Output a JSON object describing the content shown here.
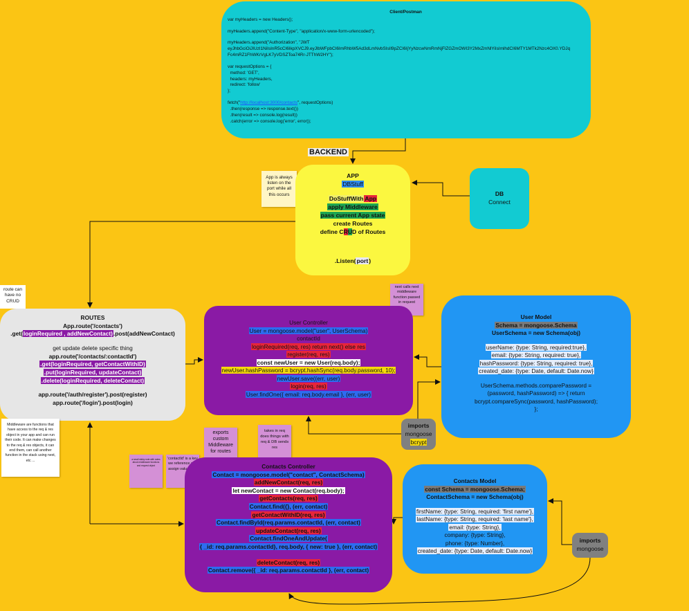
{
  "client": {
    "title": "Client/Postman",
    "lines": [
      "var myHeaders = new Headers();",
      "",
      "myHeaders.append(\"Content-Type\", \"application/x-www-form-urlencoded\");",
      "",
      "myHeaders.append(\"Authorization\", \"JWT",
      "eyJhbGciOiJIUzI1NiIsInR5cCI6IkpXVCJ9.eyJlbWFpbCI6ImRhbW5Ad3dLmNvbSIsIl9pZCI6IjYyNzcwNmRmNjFlZGZmOWI3Y2MxZmNlYiIsImlhdCI6MTY1MTk2Nzc4OX0.YDJq",
      "Fc4mRZ1FhWKrVgLK7yVDSZToa74Rr-JTThW2HY\");",
      "",
      "var requestOptions = {",
      "  method: 'GET',",
      "  headers: myHeaders,",
      "  redirect: 'follow'",
      "};",
      "",
      "fetch(\"http://localhost:3000/contacts\", requestOptions)",
      "  .then(response => response.text())",
      "  .then(result => console.log(result))",
      "  .catch(error => console.log('error', error));"
    ],
    "fetch_url": "http://localhost:3000/contacts"
  },
  "backend_label": "BACKEND",
  "app": {
    "title": "APP",
    "db_stuff": "DBStuff",
    "do_stuff": "DoStuffWith",
    "do_stuff_app": "App",
    "apply_middleware": "apply Middleware",
    "pass_state": "pass current App state",
    "create_routes": "create Routes",
    "define_crud_pre": "define C",
    "define_crud_r": "R",
    "define_crud_u": "U",
    "define_crud_d": "D",
    "define_crud_post": " of Routes",
    "listen": ".Listen(",
    "listen_arg": "port",
    "listen_close": ")"
  },
  "note_app": "App is always listen on the port while all this occurs",
  "db": {
    "title": "DB",
    "subtitle": "Connect"
  },
  "note_route": "route can have no CRUD",
  "routes": {
    "title": "ROUTES",
    "line1": "App.route('/contacts')",
    "get1_pre": ".get(",
    "get1_mw": "loginRequired",
    "get1_rest": ", addNewContact)",
    "post1": ".post(addNewContact)",
    "desc": "get update delete specific thing",
    "line2": "app.route('/contacts/:contactId')",
    "get2": ".get(loginRequired, getContactWithID)",
    "put2": ".put(loginRequired, updateContact)",
    "del2": ".delete(loginRequired, deleteContact)",
    "line3": "app.route('/auth/register').post(register)",
    "line4": "app.route('/login').post(login)"
  },
  "note_mw": "Middleware are functions that have access to the req & res object in your app and can run their code. It can make changes to the req & res objects, it can end them, can call another function in the stack using next, etc ...",
  "user_controller": {
    "title": "User Controller",
    "l1": "User = mongoose.model(\"user\", UserSchema)",
    "l2": "contactId",
    "l3": "loginRequired(req, res) return next() else res",
    "l4": "register(req, res)",
    "l5": "const newUser = new User(req.body);",
    "l6": "newUser.hashPassword = bcrypt.hashSync(req.body.password, 10);",
    "l7": "newUser.save((err, user)",
    "l8": "login(req, res)",
    "l9": "User.findOne({ email: req.body.email }, (err, user)"
  },
  "note_next": "next calls next middleware function passed in request",
  "user_model": {
    "title": "User Model",
    "l1": "Schema = mongoose.Schema",
    "l2": "UserSchema = new Schema(obj)",
    "f1": "userName: {type: String, required:true},",
    "f2": "email: {type: String, required: true},",
    "f3": "hashPassword: {type: String, required: true},",
    "f4": "created_date: {type: Date, default: Date.now}",
    "m1": "UserSchema.methods.comparePassword =",
    "m2": "(password, hashPassword) => { return",
    "m3": "bcrypt.compareSync(password, hashPassword);",
    "m4": "};"
  },
  "imports1": {
    "title": "imports",
    "a": "mongoose",
    "b": "bcrypt"
  },
  "note_exports": "exports custom Middleware for routes",
  "note_takes": "takes in req does things with req & DB sends res",
  "note_small": "a small sticky note with notes about middleware functions and request object",
  "note_cid": "'contactId' is a key we reference and assign value of id",
  "contacts_controller": {
    "title": "Contacts Controller",
    "l1": "Contact = mongoose.model(\"contact\", ContactSchema)",
    "l2": "addNewContact(req, res)",
    "l3": "let newContact = new Contact(req.body);",
    "l4": "getContacts(req, res)",
    "l5": "Contact.find({}, (err, contact)",
    "l6": "getContactWithID(req, res)",
    "l7": "Contact.findById(req.params.contactId, (err, contact)",
    "l8": "updateContact(req, res)",
    "l9": "Contact.findOneAndUpdate(",
    "l10": "{ _id: req.params.contactId}, req.body, { new: true }, (err, contact)",
    "l11": "deleteContact(req, res)",
    "l12": "Contact.remove({ _id: req.params.contactId }, (err, contact)"
  },
  "contacts_model": {
    "title": "Contacts Model",
    "l1": "const Schema = mongoose.Schema;",
    "l2": "ContactSchema = new Schema(obj)",
    "f1": "firstName: {type: String, required: 'first name'},",
    "f2": "lastName: {type: String, required: 'last name'},",
    "f3": "email: {type: String},",
    "f4": "company: {type: String},",
    "f5": "phone: {type: Number},",
    "f6": "created_date: {type: Date, default: Date.now}"
  },
  "imports2": {
    "title": "imports",
    "a": "mongoose"
  },
  "colors": {
    "board": "#fbc514",
    "cyan": "#12cbd2",
    "yellow": "#fbf740",
    "gray": "#e6e6e6",
    "purple": "#8a1aa5",
    "blue": "#2196f3",
    "sticky_pink": "#d490d6",
    "hl_red": "#e8253a",
    "hl_green": "#1ea652",
    "hl_blue": "#2d6cf0",
    "hl_gray": "#7a7a7a",
    "hl_yellow": "#f5d90a"
  }
}
